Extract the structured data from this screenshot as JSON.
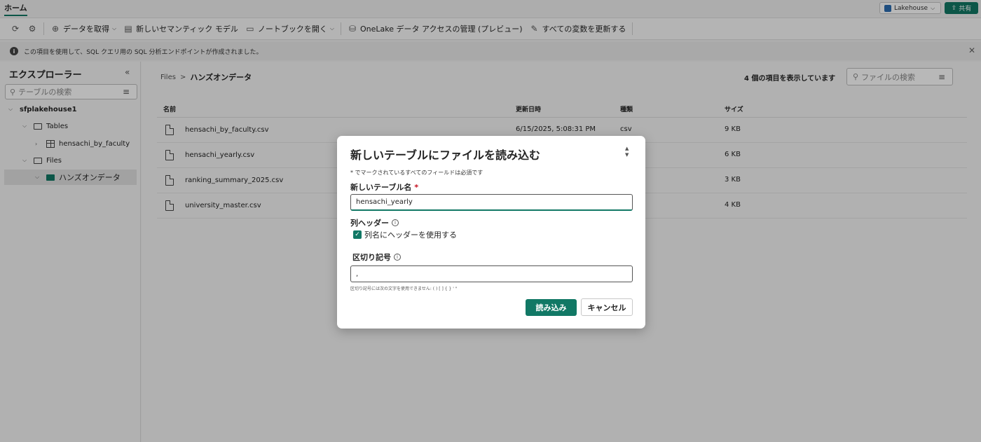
{
  "topbar": {
    "home_tab": "ホーム",
    "lakehouse_label": "Lakehouse",
    "share_label": "共有"
  },
  "ribbon": {
    "get_data": "データを取得",
    "new_semantic_model": "新しいセマンティック モデル",
    "open_notebook": "ノートブックを開く",
    "onelake_access": "OneLake データ アクセスの管理 (プレビュー)",
    "refresh_vars": "すべての変数を更新する"
  },
  "infobar": {
    "message": "この項目を使用して、SQL クエリ用の SQL 分析エンドポイントが作成されました。"
  },
  "explorer": {
    "title": "エクスプローラー",
    "search_placeholder": "テーブルの検索",
    "tree": {
      "lakehouse": "sfplakehouse1",
      "tables": "Tables",
      "table1": "hensachi_by_faculty",
      "files": "Files",
      "folder1": "ハンズオンデータ"
    }
  },
  "main": {
    "breadcrumb_root": "Files",
    "breadcrumb_sep": ">",
    "breadcrumb_current": "ハンズオンデータ",
    "item_count": "4 個の項目を表示しています",
    "search_placeholder": "ファイルの検索",
    "columns": {
      "name": "名前",
      "modified": "更新日時",
      "type": "種類",
      "size": "サイズ"
    },
    "files": [
      {
        "name": "hensachi_by_faculty.csv",
        "modified": "6/15/2025, 5:08:31 PM",
        "type": "csv",
        "size": "9 KB"
      },
      {
        "name": "hensachi_yearly.csv",
        "modified": "",
        "type": "",
        "size": "6 KB"
      },
      {
        "name": "ranking_summary_2025.csv",
        "modified": "",
        "type": "",
        "size": "3 KB"
      },
      {
        "name": "university_master.csv",
        "modified": "",
        "type": "",
        "size": "4 KB"
      }
    ]
  },
  "dialog": {
    "title": "新しいテーブルにファイルを読み込む",
    "required_note": "* でマークされているすべてのフィールドは必須です",
    "table_name_label": "新しいテーブル名",
    "table_name_value": "hensachi_yearly",
    "header_label": "列ヘッダー",
    "header_checkbox": "列名にヘッダーを使用する",
    "delimiter_label": "区切り記号",
    "delimiter_value": ",",
    "delimiter_hint": "区切り記号には次の文字を使用できません: ( ) [ ] { } ' \"",
    "load_button": "読み込み",
    "cancel_button": "キャンセル"
  }
}
